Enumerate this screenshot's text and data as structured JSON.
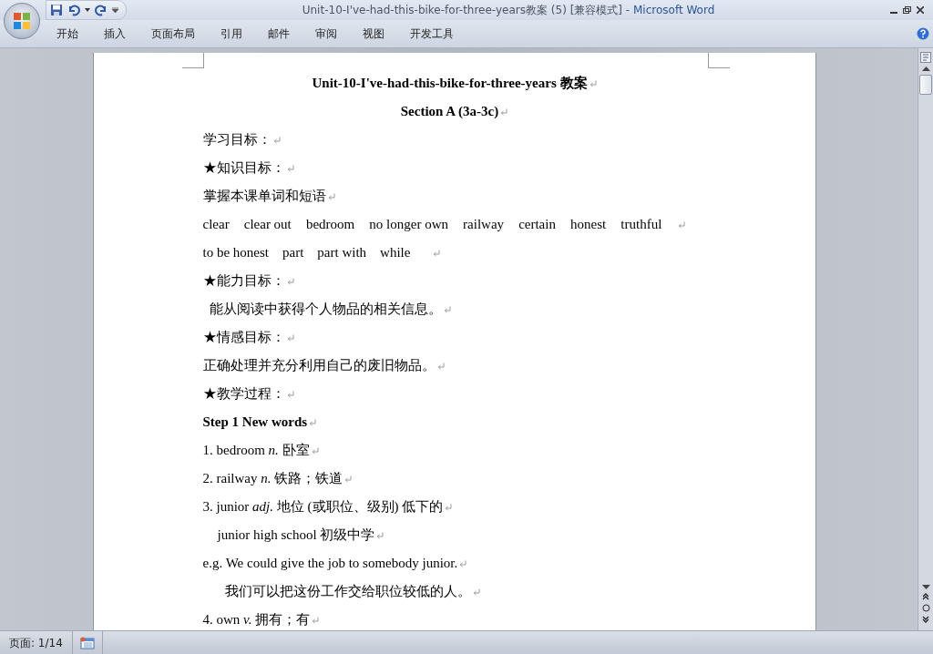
{
  "window": {
    "title": "Unit-10-I've-had-this-bike-for-three-years教案 (5) [兼容模式] -",
    "app_name": "Microsoft Word"
  },
  "ribbon_tabs": [
    {
      "label": "开始"
    },
    {
      "label": "插入"
    },
    {
      "label": "页面布局"
    },
    {
      "label": "引用"
    },
    {
      "label": "邮件"
    },
    {
      "label": "审阅"
    },
    {
      "label": "视图"
    },
    {
      "label": "开发工具"
    }
  ],
  "document": {
    "paragraphs": [
      {
        "kind": "title",
        "text": "Unit-10-I've-had-this-bike-for-three-years 教案"
      },
      {
        "kind": "title",
        "text": "Section A (3a-3c)"
      },
      {
        "kind": "normal",
        "text": "学习目标："
      },
      {
        "kind": "normal",
        "text": "★知识目标："
      },
      {
        "kind": "normal",
        "text": "掌握本课单词和短语"
      },
      {
        "kind": "spread",
        "words": [
          "clear",
          "clear out",
          "bedroom",
          "no longer own",
          "railway",
          "certain",
          "honest",
          "truthful"
        ]
      },
      {
        "kind": "words",
        "words": [
          "to be honest",
          "part",
          "part with",
          "while"
        ]
      },
      {
        "kind": "normal",
        "text": "★能力目标："
      },
      {
        "kind": "nudged",
        "text": "能从阅读中获得个人物品的相关信息。"
      },
      {
        "kind": "normal",
        "text": "★情感目标："
      },
      {
        "kind": "normal",
        "text": "正确处理并充分利用自己的废旧物品。"
      },
      {
        "kind": "normal",
        "text": "★教学过程："
      },
      {
        "kind": "heading",
        "text": "Step 1 New words"
      },
      {
        "kind": "normal",
        "text": "1. bedroom *n.*  卧室"
      },
      {
        "kind": "normal",
        "text": "2. railway *n.*  铁路；铁道"
      },
      {
        "kind": "normal",
        "text": "3. junior *adj.*  地位 (或职位、级别) 低下的"
      },
      {
        "kind": "indented",
        "text": "junior high school  初级中学"
      },
      {
        "kind": "normal",
        "text": "e.g. We could give the job to somebody junior."
      },
      {
        "kind": "deep",
        "text": "我们可以把这份工作交给职位较低的人。"
      },
      {
        "kind": "normal",
        "text": "4. own *v.*  拥有；有"
      }
    ]
  },
  "status_bar": {
    "page": "页面: 1/14"
  }
}
